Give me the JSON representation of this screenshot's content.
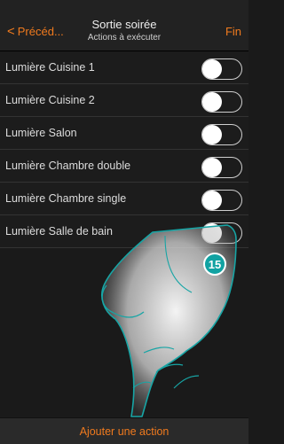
{
  "header": {
    "back_label": "Précéd...",
    "title": "Sortie soirée",
    "subtitle": "Actions à exécuter",
    "done_label": "Fin"
  },
  "actions": [
    {
      "label": "Lumière Cuisine 1",
      "enabled": false
    },
    {
      "label": "Lumière Cuisine 2",
      "enabled": false
    },
    {
      "label": "Lumière Salon",
      "enabled": false
    },
    {
      "label": "Lumière Chambre double",
      "enabled": false
    },
    {
      "label": "Lumière Chambre single",
      "enabled": false
    },
    {
      "label": "Lumière Salle de bain",
      "enabled": false
    }
  ],
  "footer": {
    "add_action_label": "Ajouter une action"
  },
  "annotation": {
    "step_number": "15"
  },
  "colors": {
    "accent": "#f07a1e",
    "badge": "#11a2a2"
  }
}
